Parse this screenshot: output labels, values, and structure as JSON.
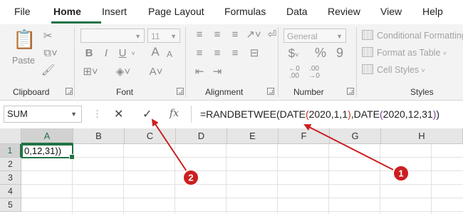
{
  "tabs": [
    "File",
    "Home",
    "Insert",
    "Page Layout",
    "Formulas",
    "Data",
    "Review",
    "View",
    "Help"
  ],
  "ribbon": {
    "clipboard": {
      "label": "Clipboard",
      "paste_label": "Paste"
    },
    "font": {
      "label": "Font",
      "font_name": "",
      "font_size": "11",
      "buttons": [
        "B",
        "I",
        "U",
        "A",
        "A"
      ]
    },
    "alignment": {
      "label": "Alignment"
    },
    "number": {
      "label": "Number",
      "format": "General",
      "currency": "$",
      "percent": "%",
      "comma": "9"
    },
    "styles": {
      "label": "Styles",
      "items": [
        "Conditional Formatting",
        "Format as Table",
        "Cell Styles"
      ]
    }
  },
  "formula_bar": {
    "name_box": "SUM",
    "cancel_icon": "✕",
    "enter_icon": "✓",
    "fx_label": "fx",
    "formula_parts": {
      "p1": "=RANDBETWEE(DATE",
      "p2": "(",
      "p3": "2020,1,1",
      "p4": ")",
      "p5": ",DATE",
      "p6": "(",
      "p7": "2020,12,31",
      "p8": ")",
      "p9": ")"
    }
  },
  "grid": {
    "columns": [
      "A",
      "B",
      "C",
      "D",
      "E",
      "F",
      "G",
      "H"
    ],
    "rows": [
      "1",
      "2",
      "3",
      "4",
      "5"
    ],
    "active_cell_text": "0,12,31))"
  },
  "annotations": {
    "badge1": "1",
    "badge2": "2",
    "color": "#cc1f1f"
  },
  "colors": {
    "accent": "#217346",
    "ribbon_bg": "#f3f3f3"
  }
}
